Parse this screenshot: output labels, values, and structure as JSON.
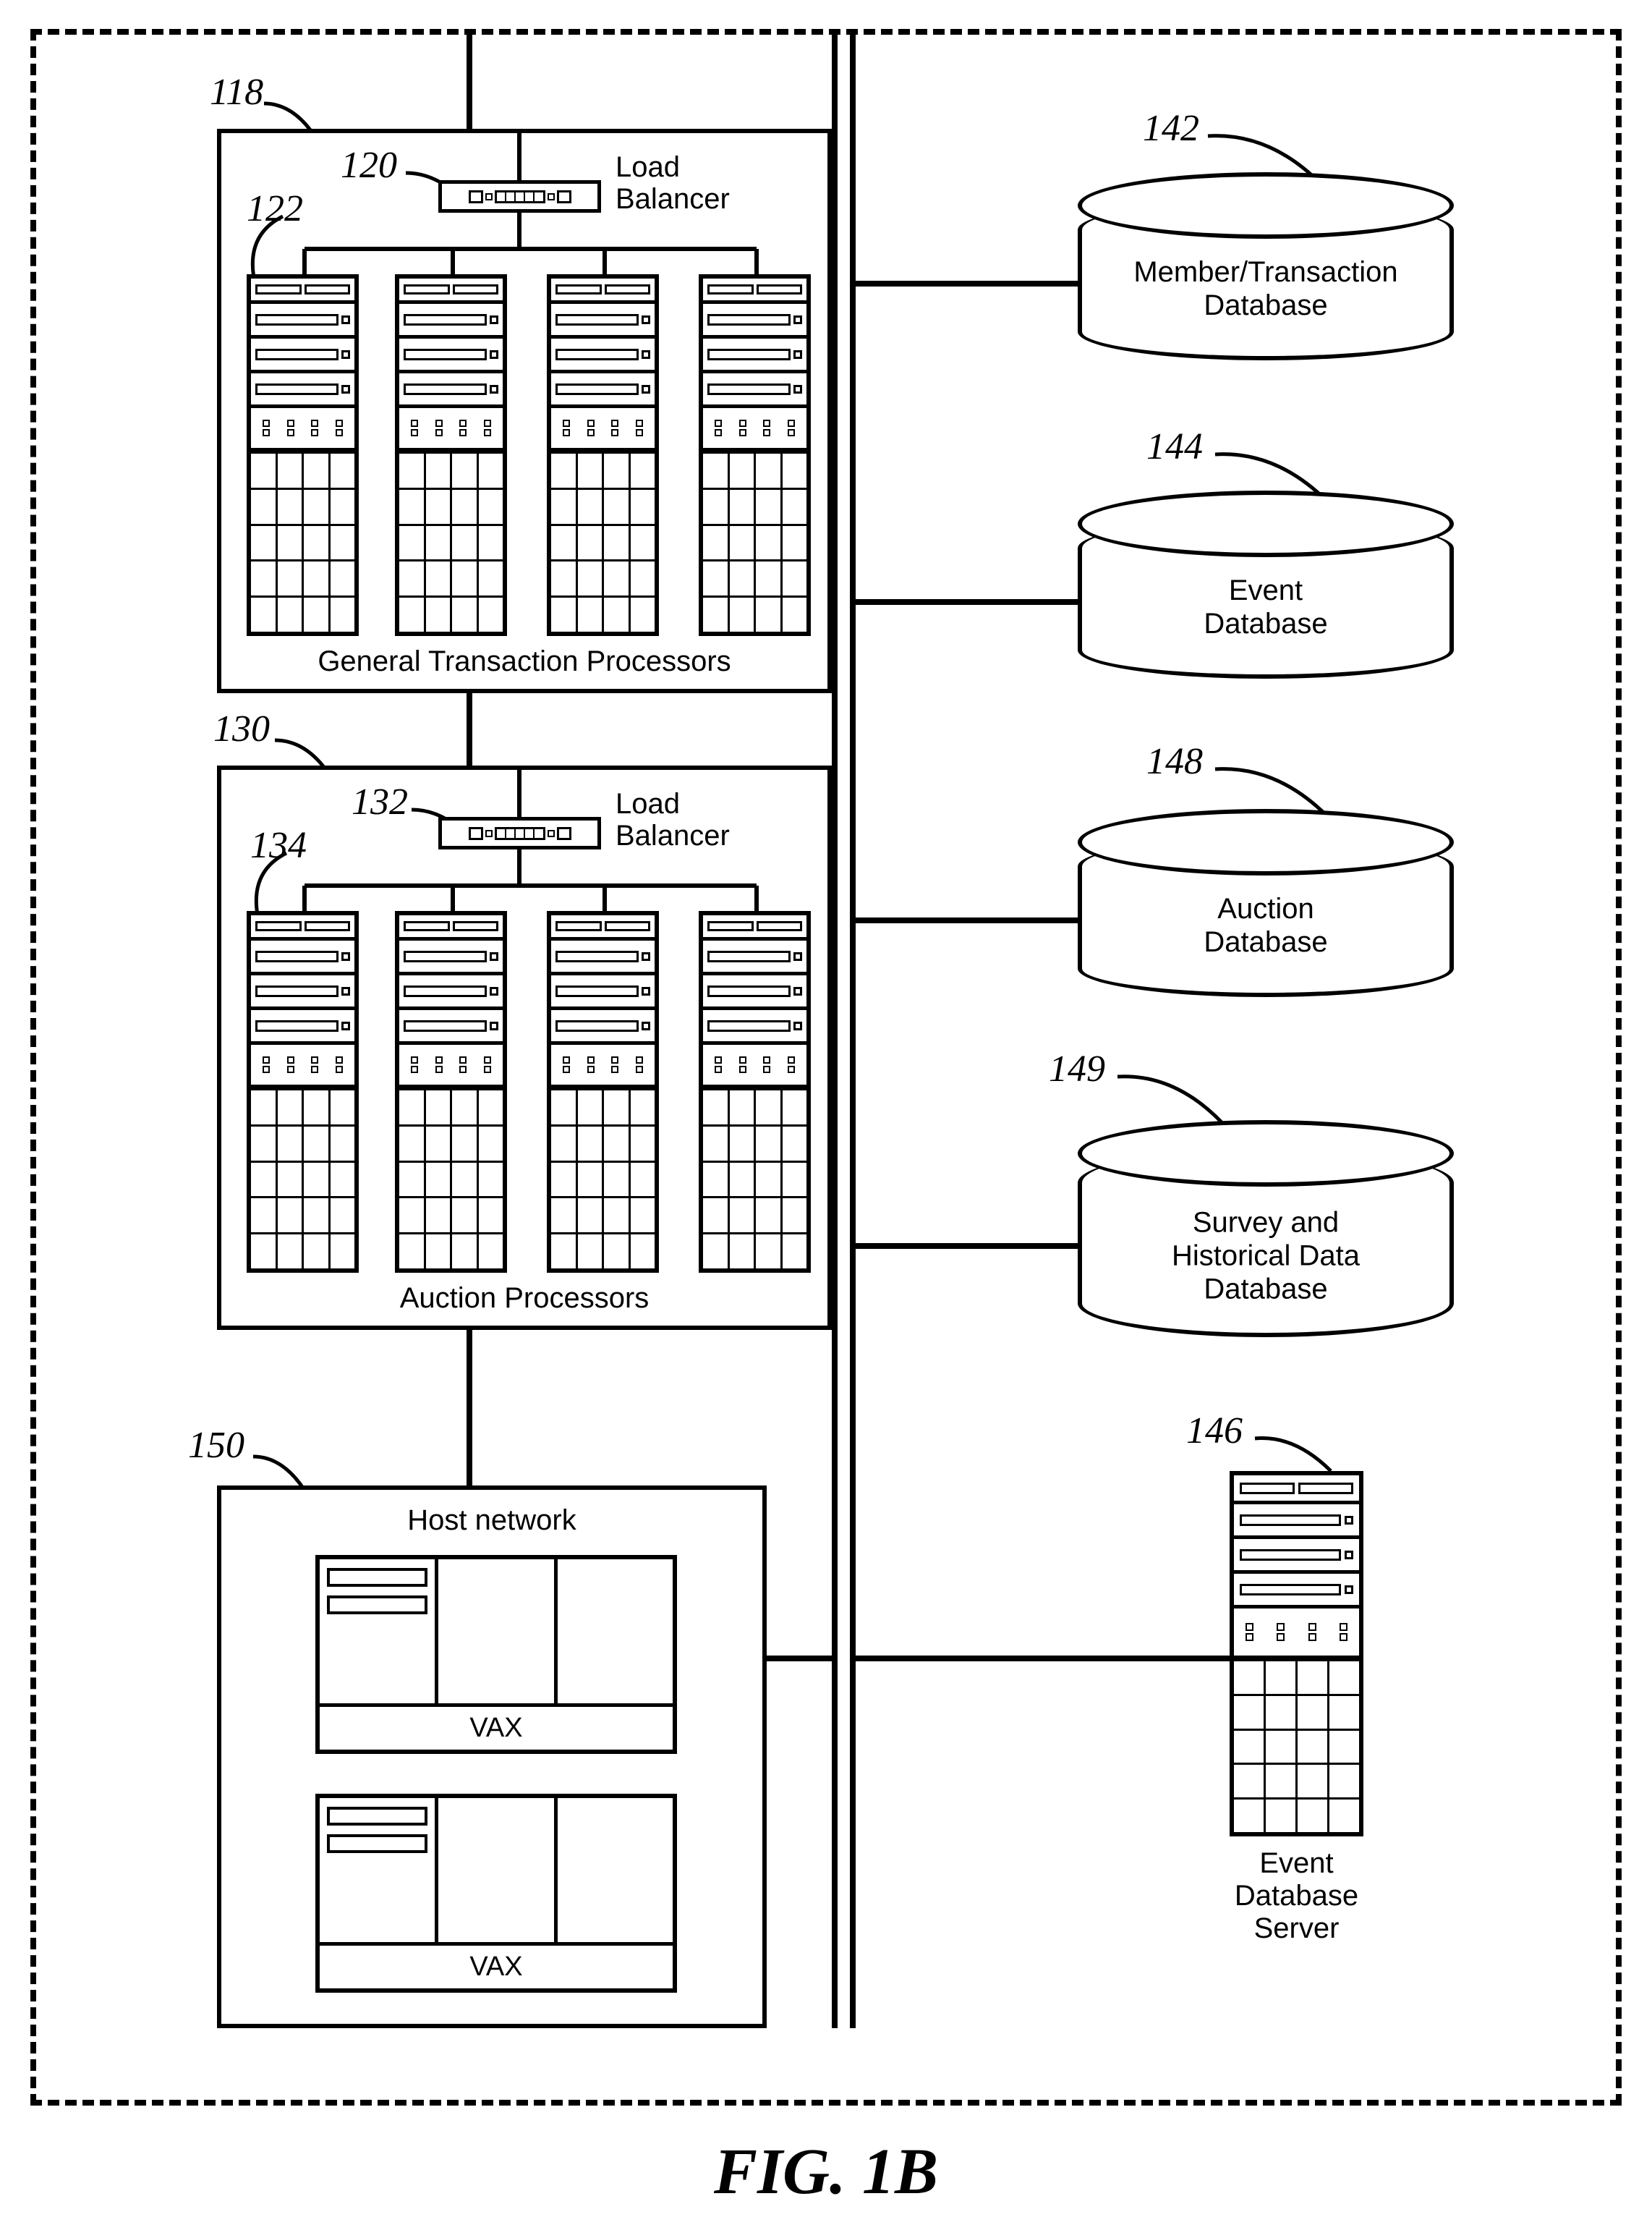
{
  "figure_caption": "FIG. 1B",
  "refs": {
    "r118": "118",
    "r120": "120",
    "r122": "122",
    "r130": "130",
    "r132": "132",
    "r134": "134",
    "r150": "150",
    "r142": "142",
    "r144": "144",
    "r148": "148",
    "r149": "149",
    "r146": "146"
  },
  "labels": {
    "load_balancer": "Load\nBalancer",
    "gtp": "General Transaction Processors",
    "auction_proc": "Auction Processors",
    "host_network": "Host network",
    "vax": "VAX",
    "db_member": "Member/Transaction\nDatabase",
    "db_event": "Event\nDatabase",
    "db_auction": "Auction\nDatabase",
    "db_survey": "Survey and\nHistorical Data\nDatabase",
    "event_server": "Event\nDatabase\nServer"
  }
}
